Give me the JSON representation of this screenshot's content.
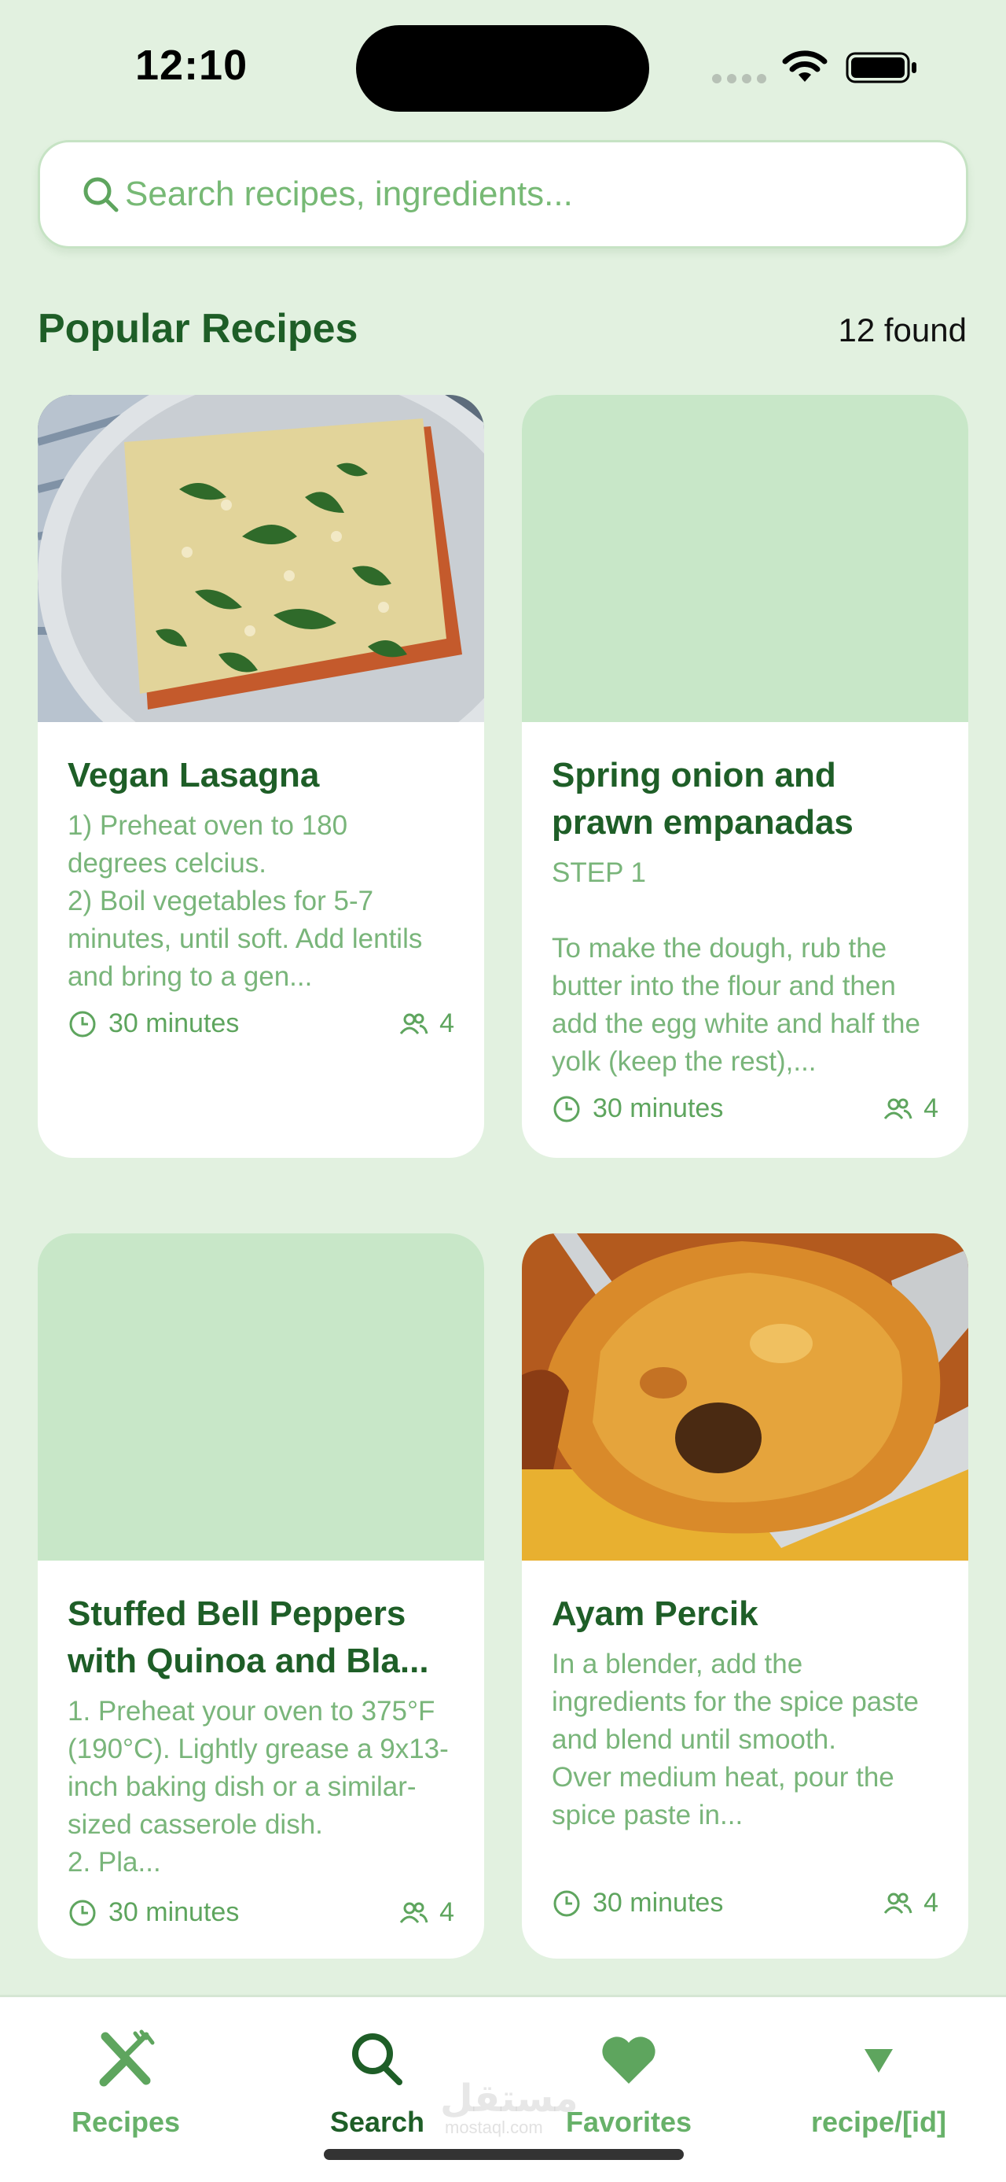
{
  "status_bar": {
    "time": "12:10"
  },
  "search": {
    "placeholder": "Search recipes, ingredients..."
  },
  "header": {
    "title": "Popular Recipes",
    "count": "12 found"
  },
  "recipes": [
    {
      "title": "Vegan Lasagna",
      "description": "1) Preheat oven to 180 degrees celcius.\n2) Boil vegetables for 5-7 minutes, until soft. Add lentils and bring to a gen...",
      "time": "30 minutes",
      "servings": "4",
      "has_image": true
    },
    {
      "title": "Spring onion and prawn empanadas",
      "description": "STEP 1\n\nTo make the dough, rub the butter into the flour and then add the egg white and half the yolk (keep the rest),...",
      "time": "30 minutes",
      "servings": "4",
      "has_image": false
    },
    {
      "title": "Stuffed Bell Peppers with Quinoa and Bla...",
      "description": "1. Preheat your oven to 375°F (190°C). Lightly grease a 9x13-inch baking dish or a similar-sized casserole dish.\n2. Pla...",
      "time": "30 minutes",
      "servings": "4",
      "has_image": false
    },
    {
      "title": "Ayam Percik",
      "description": "In a blender, add the ingredients for the spice paste and blend until smooth.\nOver medium heat, pour the spice paste in...",
      "time": "30 minutes",
      "servings": "4",
      "has_image": true
    }
  ],
  "tabs": [
    {
      "label": "Recipes",
      "icon": "fork-knife-icon",
      "active": false
    },
    {
      "label": "Search",
      "icon": "search-icon",
      "active": true
    },
    {
      "label": "Favorites",
      "icon": "heart-icon",
      "active": false
    },
    {
      "label": "recipe/[id]",
      "icon": "triangle-down-icon",
      "active": false
    }
  ],
  "watermark": {
    "text": "مستقل",
    "sub": "mostaql.com"
  },
  "colors": {
    "accent": "#1e5e27",
    "muted_green": "#79b57a",
    "background": "#e2f1e0",
    "placeholder_image": "#c8e7c8"
  }
}
